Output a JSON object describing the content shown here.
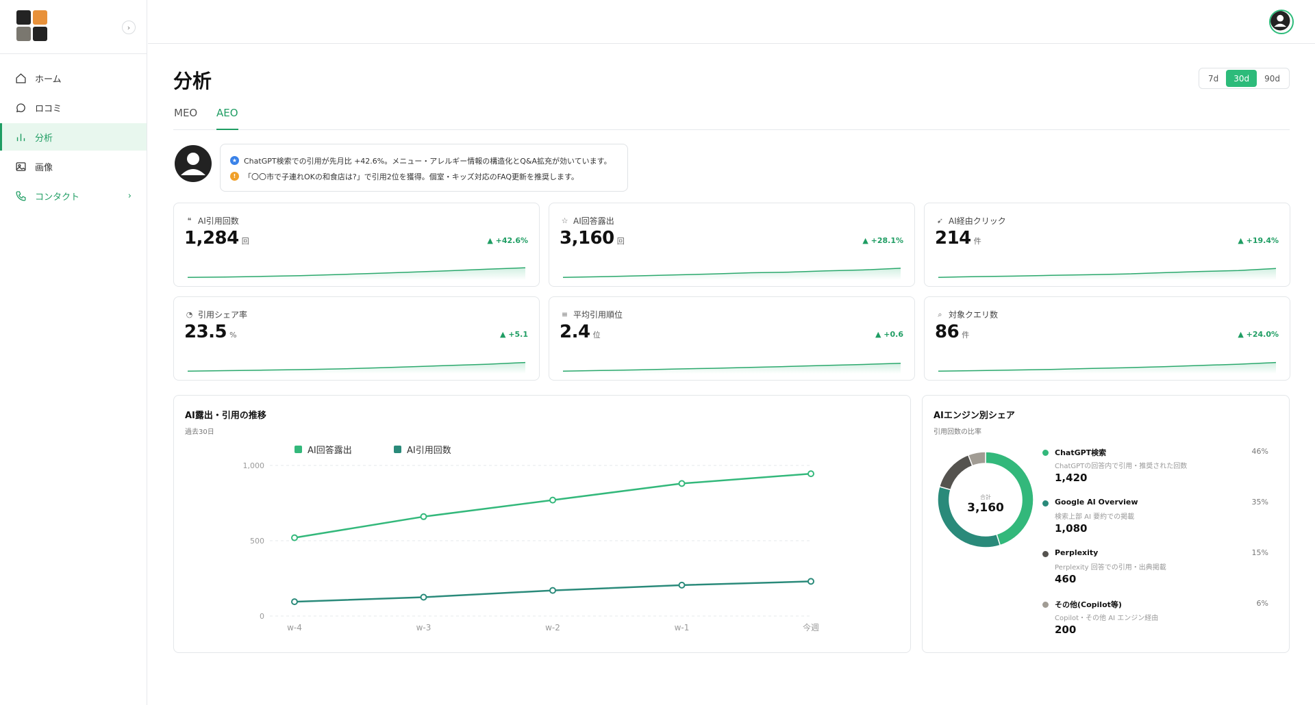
{
  "sidebar": {
    "collapse_icon": "›",
    "items": [
      {
        "label": "ホーム",
        "icon": "home-icon"
      },
      {
        "label": "ロコミ",
        "icon": "chat-icon"
      },
      {
        "label": "分析",
        "icon": "bar-chart-icon",
        "active": true
      },
      {
        "label": "画像",
        "icon": "image-icon"
      },
      {
        "label": "コンタクト",
        "icon": "phone-icon",
        "chevron": "›"
      }
    ]
  },
  "page": {
    "title": "分析",
    "ranges": [
      "7d",
      "30d",
      "90d"
    ],
    "active_range": "30d",
    "tabs": [
      "MEO",
      "AEO"
    ],
    "active_tab": "AEO"
  },
  "insight": {
    "lines": [
      "ChatGPT検索での引用が先月比 +42.6%。メニュー・アレルギー情報の構造化とQ&A拡充が効いています。",
      "「〇〇市で子連れOKの和食店は?」で引用2位を獲得。個室・キッズ対応のFAQ更新を推奨します。"
    ],
    "line_icons": [
      "star-icon",
      "alert-icon"
    ]
  },
  "kpis": [
    {
      "label": "AI引用回数",
      "icon": "quote-icon",
      "value": "1,284",
      "unit": "回",
      "delta": "+42.6%",
      "trend": [
        10,
        12,
        18,
        24,
        33,
        42,
        53,
        64,
        76,
        88
      ]
    },
    {
      "label": "AI回答露出",
      "icon": "star-icon",
      "value": "3,160",
      "unit": "回",
      "delta": "+28.1%",
      "trend": [
        10,
        15,
        22,
        30,
        38,
        47,
        52,
        62,
        70,
        84
      ]
    },
    {
      "label": "AI経由クリック",
      "icon": "cursor-icon",
      "value": "214",
      "unit": "件",
      "delta": "+19.4%",
      "trend": [
        10,
        16,
        20,
        26,
        31,
        37,
        48,
        58,
        65,
        82
      ]
    },
    {
      "label": "引用シェア率",
      "icon": "pie-icon",
      "value": "23.5",
      "unit": "%",
      "delta": "+5.1",
      "trend": [
        10,
        14,
        18,
        22,
        28,
        36,
        46,
        56,
        66,
        80
      ]
    },
    {
      "label": "平均引用順位",
      "icon": "list-icon",
      "value": "2.4",
      "unit": "位",
      "delta": "+0.6",
      "trend": [
        10,
        15,
        20,
        27,
        33,
        40,
        48,
        56,
        64,
        74
      ]
    },
    {
      "label": "対象クエリ数",
      "icon": "search-icon",
      "value": "86",
      "unit": "件",
      "delta": "+24.0%",
      "trend": [
        10,
        14,
        19,
        24,
        31,
        38,
        46,
        56,
        66,
        80
      ]
    }
  ],
  "trend_panel": {
    "title": "AI露出・引用の推移",
    "subtitle": "過去30日"
  },
  "engine_panel": {
    "title": "AIエンジン別シェア",
    "subtitle": "引用回数の比率",
    "center_label": "合計",
    "center_value": "3,160"
  },
  "engines": [
    {
      "name": "ChatGPT検索",
      "desc": "ChatGPTの回答内で引用・推奨された回数",
      "value": "1,420",
      "pct": "46%",
      "share": 46,
      "color": "#33b87b"
    },
    {
      "name": "Google AI Overview",
      "desc": "検索上部 AI 要約での掲載",
      "value": "1,080",
      "pct": "35%",
      "share": 35,
      "color": "#2a8a7a"
    },
    {
      "name": "Perplexity",
      "desc": "Perplexity 回答での引用・出典掲載",
      "value": "460",
      "pct": "15%",
      "share": 15,
      "color": "#55534f"
    },
    {
      "name": "その他(Copilot等)",
      "desc": "Copilot・その他 AI エンジン経由",
      "value": "200",
      "pct": "6%",
      "share": 6,
      "color": "#a19c94"
    }
  ],
  "chart_data": {
    "type": "line",
    "categories": [
      "w-4",
      "w-3",
      "w-2",
      "w-1",
      "今週"
    ],
    "series": [
      {
        "name": "AI回答露出",
        "values": [
          520,
          660,
          770,
          880,
          945
        ],
        "color": "#33b87b"
      },
      {
        "name": "AI引用回数",
        "values": [
          95,
          125,
          170,
          205,
          230
        ],
        "color": "#2a8a7a"
      }
    ],
    "ylim": [
      0,
      1000
    ],
    "yticks": [
      0,
      500,
      1000
    ],
    "ytick_labels": [
      "0",
      "500",
      "1,000"
    ],
    "grid": true,
    "legend": "top"
  }
}
